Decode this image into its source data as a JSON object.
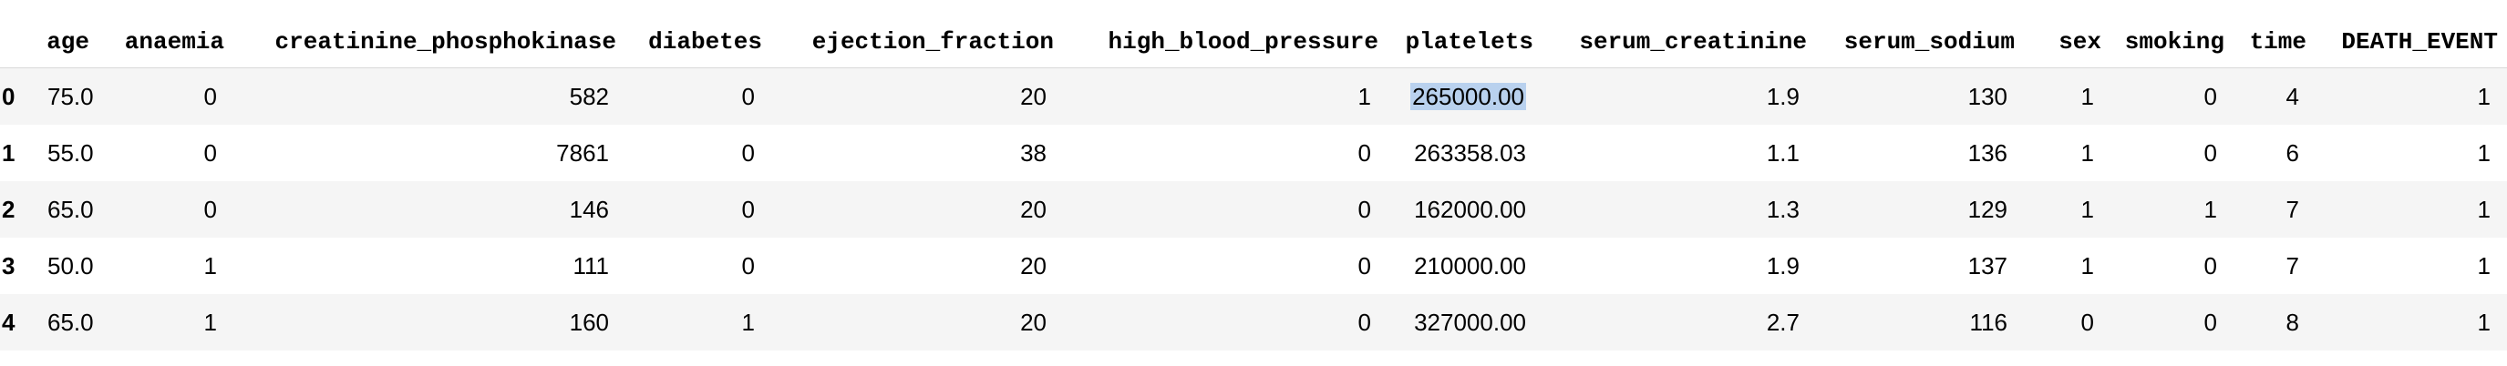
{
  "dataframe": {
    "columns": [
      "age",
      "anaemia",
      "creatinine_phosphokinase",
      "diabetes",
      "ejection_fraction",
      "high_blood_pressure",
      "platelets",
      "serum_creatinine",
      "serum_sodium",
      "sex",
      "smoking",
      "time",
      "DEATH_EVENT"
    ],
    "index": [
      "0",
      "1",
      "2",
      "3",
      "4"
    ],
    "rows": [
      [
        "75.0",
        "0",
        "582",
        "0",
        "20",
        "1",
        "265000.00",
        "1.9",
        "130",
        "1",
        "0",
        "4",
        "1"
      ],
      [
        "55.0",
        "0",
        "7861",
        "0",
        "38",
        "0",
        "263358.03",
        "1.1",
        "136",
        "1",
        "0",
        "6",
        "1"
      ],
      [
        "65.0",
        "0",
        "146",
        "0",
        "20",
        "0",
        "162000.00",
        "1.3",
        "129",
        "1",
        "1",
        "7",
        "1"
      ],
      [
        "50.0",
        "1",
        "111",
        "0",
        "20",
        "0",
        "210000.00",
        "1.9",
        "137",
        "1",
        "0",
        "7",
        "1"
      ],
      [
        "65.0",
        "1",
        "160",
        "1",
        "20",
        "0",
        "327000.00",
        "2.7",
        "116",
        "0",
        "0",
        "8",
        "1"
      ]
    ],
    "highlight_color": "#b9d1ee",
    "stripe_color": "#f5f5f5"
  }
}
